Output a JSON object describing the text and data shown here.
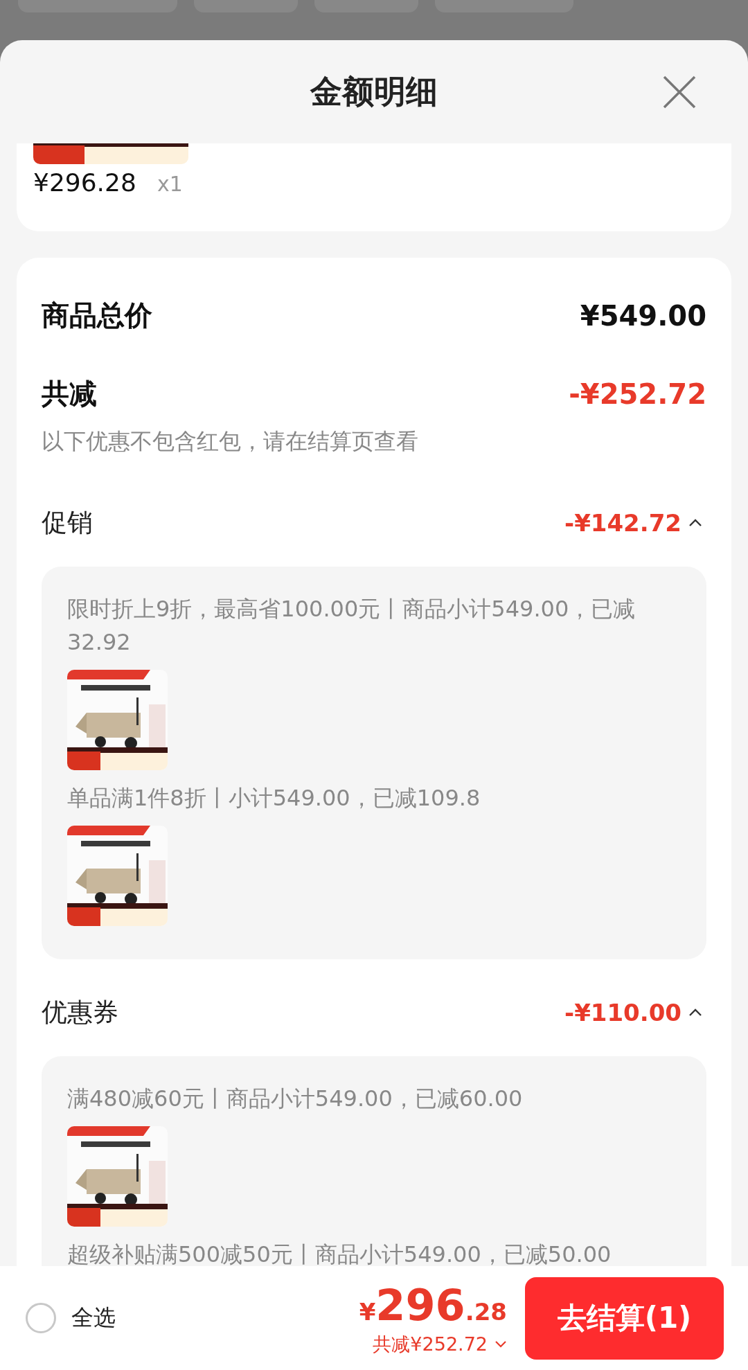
{
  "sheet": {
    "title": "金额明细"
  },
  "top_item": {
    "thumbnail": {
      "kind": "picture"
    },
    "price": "¥296.28",
    "quantity": "x1"
  },
  "summary": {
    "total_label": "商品总价",
    "total": "¥549.00",
    "discount_label": "共减",
    "discount": "-¥252.72",
    "note": "以下优惠不包含红包，请在结算页查看"
  },
  "sections": [
    {
      "label": "促销",
      "amount": "-¥142.72",
      "expanded": true,
      "entries": [
        {
          "kind": "text",
          "text": "限时折上9折，最高省100.00元丨商品小计549.00，已减32.92"
        },
        {
          "kind": "picture"
        },
        {
          "kind": "text",
          "text": "单品满1件8折丨小计549.00，已减109.8"
        },
        {
          "kind": "picture"
        }
      ]
    },
    {
      "label": "优惠券",
      "amount": "-¥110.00",
      "expanded": true,
      "entries": [
        {
          "kind": "text",
          "text": "满480减60元丨商品小计549.00，已减60.00"
        },
        {
          "kind": "picture"
        },
        {
          "kind": "text",
          "text": "超级补贴满500减50元丨商品小计549.00，已减50.00"
        }
      ]
    }
  ],
  "bottom_bar": {
    "select_all": {
      "label": "全选",
      "checked": false
    },
    "currency": "¥",
    "price_integer": "296",
    "price_decimal": ".28",
    "saving": "共减¥252.72",
    "checkout": "去结算(1)"
  }
}
